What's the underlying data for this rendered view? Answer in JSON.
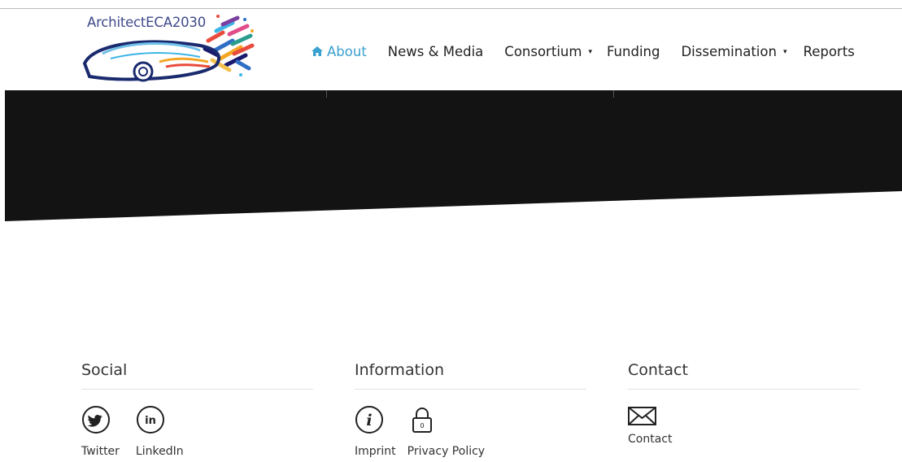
{
  "logo": {
    "text": "ArchitectECA2030"
  },
  "nav": {
    "items": [
      {
        "label": "About",
        "active": true
      },
      {
        "label": "News & Media"
      },
      {
        "label": "Consortium",
        "dropdown": true
      },
      {
        "label": "Funding"
      },
      {
        "label": "Dissemination",
        "dropdown": true
      },
      {
        "label": "Reports"
      }
    ]
  },
  "colors": {
    "accent": "#3aa0d0",
    "hero": "#131313"
  },
  "footer": {
    "social": {
      "title": "Social",
      "links": [
        {
          "label": "Twitter",
          "icon": "twitter-icon"
        },
        {
          "label": "LinkedIn",
          "icon": "linkedin-icon"
        }
      ]
    },
    "information": {
      "title": "Information",
      "links": [
        {
          "label": "Imprint",
          "icon": "info-icon"
        },
        {
          "label": "Privacy Policy",
          "icon": "lock-icon"
        }
      ]
    },
    "contact": {
      "title": "Contact",
      "links": [
        {
          "label": "Contact",
          "icon": "envelope-icon"
        }
      ]
    }
  }
}
